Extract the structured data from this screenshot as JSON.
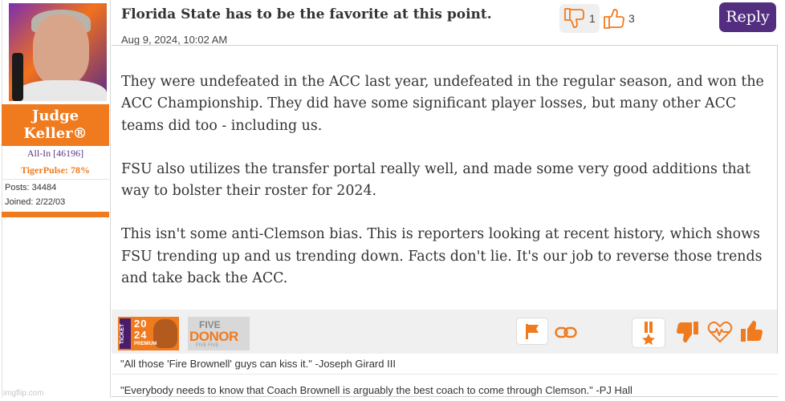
{
  "user": {
    "name_line1": "Judge",
    "name_line2": "Keller®",
    "rank": "All-In [46196]",
    "tigerpulse": "TigerPulse: 78%",
    "posts": "Posts: 34484",
    "joined": "Joined: 2/22/03"
  },
  "post": {
    "title": "Florida State has to be the favorite at this point.",
    "date": "Aug 9, 2024, 10:02 AM",
    "thumbs_down_count": "1",
    "thumbs_up_count": "3",
    "reply_label": "Reply",
    "paragraphs": [
      "They were undefeated in the ACC last year, undefeated in the regular season, and won the ACC Championship. They did have some significant player losses, but many other ACC teams did too - including us.",
      "FSU also utilizes the transfer portal really well, and made some very good additions that way to bolster their roster for 2024.",
      "This isn't some anti-Clemson bias. This is reporters looking at recent history, which shows FSU trending up and us trending down. Facts don't lie. It's our job to reverse those trends and take back the ACC."
    ]
  },
  "badges": {
    "ticket_side": "TICKET",
    "ticket_year_top": "20",
    "ticket_year_bottom": "24",
    "ticket_premium": "PREMIUM",
    "donor_top": "FIVE",
    "donor_main": "DONOR",
    "donor_bottom": "FIVE FIVE"
  },
  "signature": {
    "line1": "\"All those 'Fire Brownell' guys can kiss it.\" -Joseph Girard III",
    "line2": "\"Everybody needs to know that Coach Brownell is arguably the best coach to come through Clemson.\" -PJ Hall"
  },
  "icons": {
    "thumbs_down_outline": "thumbs-down-outline-icon",
    "thumbs_up_outline": "thumbs-up-outline-icon",
    "flag": "flag-icon",
    "link": "link-icon",
    "medal": "medal-icon",
    "thumbs_down": "thumbs-down-icon",
    "heartbeat": "heartbeat-icon",
    "thumbs_up": "thumbs-up-icon"
  },
  "colors": {
    "orange": "#f07a1e",
    "purple": "#522d80"
  },
  "watermark": "imgflip.com"
}
